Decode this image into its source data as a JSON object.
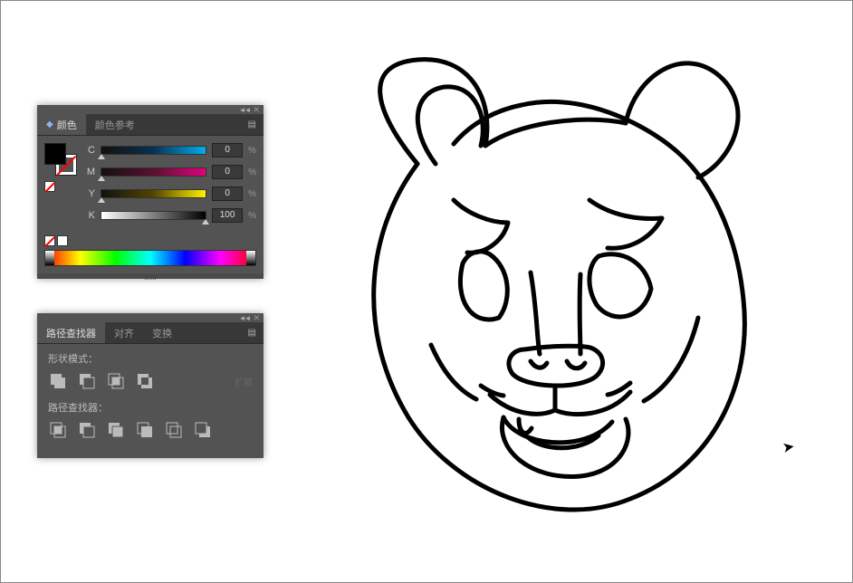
{
  "color_panel": {
    "tab_color": "颜色",
    "tab_color_guide": "颜色参考",
    "channels": {
      "c": {
        "label": "C",
        "value": "0"
      },
      "m": {
        "label": "M",
        "value": "0"
      },
      "y": {
        "label": "Y",
        "value": "0"
      },
      "k": {
        "label": "K",
        "value": "100"
      }
    },
    "pct": "%"
  },
  "pathfinder_panel": {
    "tab_pathfinder": "路径查找器",
    "tab_align": "对齐",
    "tab_transform": "变换",
    "shape_modes_label": "形状模式：",
    "pathfinders_label": "路径查找器：",
    "expand_label": "扩展"
  }
}
